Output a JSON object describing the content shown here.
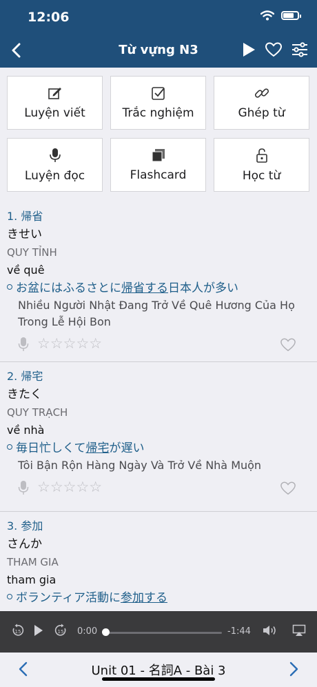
{
  "status": {
    "time": "12:06"
  },
  "nav": {
    "title": "Từ vựng N3"
  },
  "tiles": [
    {
      "label": "Luyện viết",
      "icon": "pencil-icon"
    },
    {
      "label": "Trắc nghiệm",
      "icon": "checkbox-icon"
    },
    {
      "label": "Ghép từ",
      "icon": "link-icon"
    },
    {
      "label": "Luyện đọc",
      "icon": "microphone-icon"
    },
    {
      "label": "Flashcard",
      "icon": "cards-icon"
    },
    {
      "label": "Học từ",
      "icon": "unlock-icon"
    }
  ],
  "words": [
    {
      "title": "1. 帰省",
      "kana": "きせい",
      "hanviet": "QUY TỈNH",
      "meaning": "về quê",
      "example_pre": "お盆にはふるさとに",
      "example_hl": "帰省する",
      "example_post": "日本人が多い",
      "translation": "Nhiều Người Nhật Đang Trở Về Quê Hương Của Họ Trong Lễ Hội Bon",
      "stars": "☆☆☆☆☆"
    },
    {
      "title": "2. 帰宅",
      "kana": "きたく",
      "hanviet": "QUY TRẠCH",
      "meaning": "về nhà",
      "example_pre": "毎日忙しくて",
      "example_hl": "帰宅",
      "example_post": "が遅い",
      "translation": "Tôi Bận Rộn Hàng Ngày Và Trở Về Nhà Muộn",
      "stars": "☆☆☆☆☆"
    },
    {
      "title": "3. 参加",
      "kana": "さんか",
      "hanviet": "THAM GIA",
      "meaning": "tham gia",
      "example_pre": "ボランティア活動に",
      "example_hl": "参加する",
      "example_post": ""
    }
  ],
  "player": {
    "current": "0:00",
    "remaining": "-1:44",
    "progress": 0
  },
  "bottom": {
    "title": "Unit 01 - 名詞A - Bài 3"
  }
}
